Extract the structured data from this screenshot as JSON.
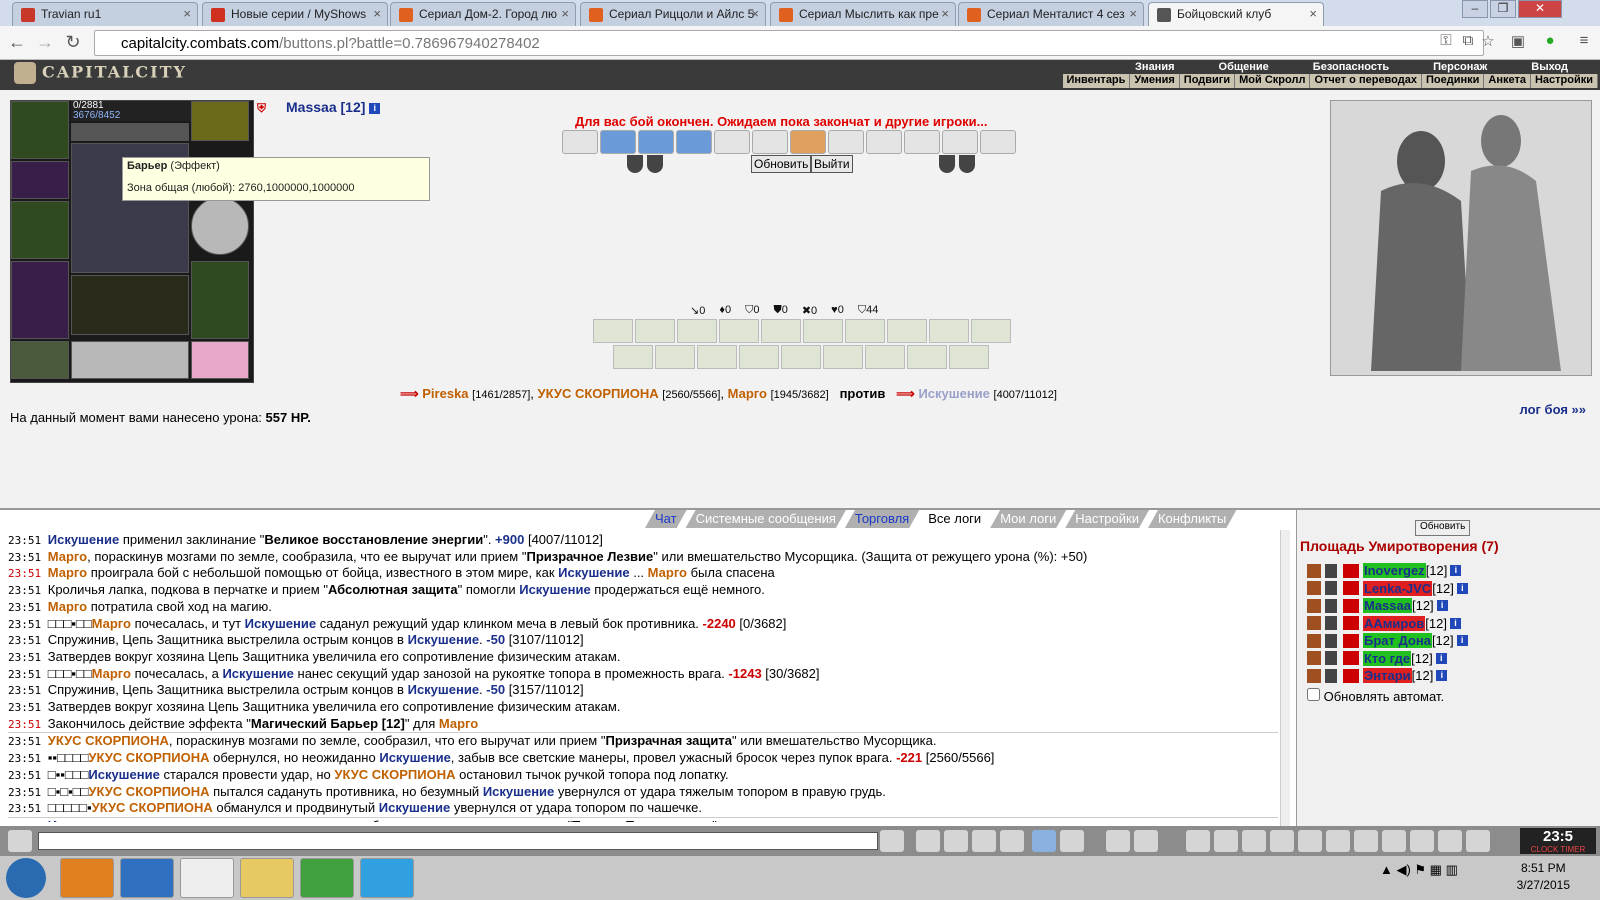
{
  "browser": {
    "tabs": [
      {
        "title": "Travian ru1",
        "color": "#c8382a"
      },
      {
        "title": "Новые серии / MyShows",
        "color": "#d03020"
      },
      {
        "title": "Сериал Дом-2. Город лю",
        "color": "#e06020"
      },
      {
        "title": "Сериал Риццоли и Айлс 5",
        "color": "#e06020"
      },
      {
        "title": "Сериал Мыслить как пре",
        "color": "#e06020"
      },
      {
        "title": "Сериал Менталист 4 сез",
        "color": "#e06020"
      },
      {
        "title": "Бойцовский клуб",
        "color": "#555555"
      }
    ],
    "url_host": "capitalcity.combats.com",
    "url_path": "/buttons.pl?battle=0.786967940278402"
  },
  "site": {
    "logo": "CAPITALCITY",
    "menu_top": [
      "Знания",
      "Общение",
      "Безопасность",
      "Персонаж",
      "Выход"
    ],
    "menu_sub": [
      "Инвентарь",
      "Умения",
      "Подвиги",
      "Мой Скролл",
      "Отчет о переводах",
      "Поединки",
      "Анкета",
      "Настройки"
    ]
  },
  "character": {
    "name": "Massaa [12]",
    "hp": "0/2881",
    "mana": "3676/8452",
    "tooltip_title": "Барьер",
    "tooltip_kind": "(Эффект)",
    "tooltip_body": "Зона общая (любой): 2760,1000000,1000000"
  },
  "battle": {
    "status": "Для вас бой окончен. Ожидаем пока закончат и другие игроки...",
    "refresh_btn": "Обновить",
    "exit_btn": "Выйти",
    "stats": [
      "↘0",
      "♦0",
      "⛉0",
      "⛊0",
      "✖0",
      "♥0",
      "⛉44"
    ],
    "team1": [
      {
        "name": "Pireska",
        "hp": "[1461/2857]"
      },
      {
        "name": "УКУС СКОРПИОНА",
        "hp": "[2560/5566]"
      },
      {
        "name": "Марго",
        "hp": "[1945/3682]"
      }
    ],
    "vs": "против",
    "team2": [
      {
        "name": "Искушение",
        "hp": "[4007/11012]"
      }
    ],
    "damage_label": "На данный момент вами нанесено урона:",
    "damage_value": "557 HP.",
    "log_link": "лог боя »»"
  },
  "chat": {
    "tabs": [
      "Чат",
      "Системные сообщения",
      "Торговля",
      "Все логи",
      "Мои логи",
      "Настройки",
      "Конфликты"
    ],
    "log": [
      {
        "time": "23:51",
        "red": false,
        "html": "<span class='nb'>Искушение</span> применил заклинание \"<span class='bold'>Великое восстановление энергии</span>\". <span class='nb'>+900</span> [4007/11012]"
      },
      {
        "time": "23:51",
        "red": false,
        "html": "<span class='no'>Марго</span>, пораскинув мозгами по земле, сообразила, что ее выручат или прием \"<span class='bold'>Призрачное Лезвие</span>\" или вмешательство Мусорщика. (Защита от режущего урона (%): +50)"
      },
      {
        "time": "23:51",
        "red": true,
        "html": "<span class='no'>Марго</span> проиграла бой с небольшой помощью от бойца, известного в этом мире, как <span class='nb'>Искушение</span> ... <span class='no'>Марго</span> была спасена"
      },
      {
        "time": "23:51",
        "red": false,
        "html": "Кроличья лапка, подкова в перчатке и прием \"<span class='bold'>Абсолютная защита</span>\" помогли <span class='nb'>Искушение</span> продержаться ещё немного."
      },
      {
        "time": "23:51",
        "red": false,
        "html": "<span class='no'>Марго</span> потратила свой ход на магию."
      },
      {
        "time": "23:51",
        "red": false,
        "html": "□□□▪□□<span class='no'>Марго</span> почесалась, и тут <span class='nb'>Искушение</span> саданул режущий удар клинком меча в левый бок противника. <span class='nr'>-2240</span> [0/3682]"
      },
      {
        "time": "23:51",
        "red": false,
        "html": "Спружинив, Цепь Защитника выстрелила острым концов в <span class='nb'>Искушение</span>. <span class='nb'>-50</span> [3107/11012]"
      },
      {
        "time": "23:51",
        "red": false,
        "html": "Затвердев вокруг хозяина Цепь Защитника увеличила его сопротивление физическим атакам."
      },
      {
        "time": "23:51",
        "red": false,
        "html": "□□□▪□□<span class='no'>Марго</span> почесалась, а <span class='nb'>Искушение</span> нанес секущий удар занозой на рукоятке топора в промежность врага. <span class='nr'>-1243</span> [30/3682]"
      },
      {
        "time": "23:51",
        "red": false,
        "html": "Спружинив, Цепь Защитника выстрелила острым концов в <span class='nb'>Искушение</span>. <span class='nb'>-50</span> [3157/11012]"
      },
      {
        "time": "23:51",
        "red": false,
        "html": "Затвердев вокруг хозяина Цепь Защитника увеличила его сопротивление физическим атакам."
      },
      {
        "time": "23:51",
        "red": true,
        "html": "Закончилось действие эффекта \"<span class='bold'>Магический Барьер [12]</span>\" для <span class='no'>Марго</span>"
      },
      {
        "time": "23:51",
        "red": false,
        "sep": true,
        "html": "<span class='no'>УКУС СКОРПИОНА</span>, пораскинув мозгами по земле, сообразил, что его выручат или прием \"<span class='bold'>Призрачная защита</span>\" или вмешательство Мусорщика."
      },
      {
        "time": "23:51",
        "red": false,
        "html": "▪▪□□□□<span class='no'>УКУС СКОРПИОНА</span> обернулся, но неожиданно <span class='nb'>Искушение</span>, забыв все светские манеры, провел ужасный бросок через пупок врага. <span class='nr'>-221</span> [2560/5566]"
      },
      {
        "time": "23:51",
        "red": false,
        "html": "□▪▪□□□<span class='nb'>Искушение</span> старался провести удар, но <span class='no'>УКУС СКОРПИОНА</span> остановил тычок ручкой топора под лопатку."
      },
      {
        "time": "23:51",
        "red": false,
        "html": "□▪□▪□□<span class='no'>УКУС СКОРПИОНА</span> пытался садануть противника, но безумный <span class='nb'>Искушение</span> увернулся от удара тяжелым топором в правую грудь."
      },
      {
        "time": "23:51",
        "red": false,
        "html": "□□□□□▪<span class='no'>УКУС СКОРПИОНА</span> обманулся и продвинутый <span class='nb'>Искушение</span> увернулся от удара топором по чашечке."
      },
      {
        "time": "23:51",
        "red": false,
        "sep": true,
        "html": "<span class='nb'>Искушение</span> закричал от испуга, и неожиданно для себя самого сотворил заклинание \"<span class='bold'>Тактика Парирования</span>\"."
      }
    ]
  },
  "location": {
    "refresh_btn": "Обновить",
    "title": "Площадь Умиротворения (7)",
    "players": [
      {
        "name": "Inovergez",
        "level": "[12]",
        "bg": "g"
      },
      {
        "name": "Lenka-JVC",
        "level": "[12]",
        "bg": "rd"
      },
      {
        "name": "Massaa",
        "level": "[12]",
        "bg": "g"
      },
      {
        "name": "AAмиров",
        "level": "[12]",
        "bg": "rd"
      },
      {
        "name": "Брат Дона",
        "level": "[12]",
        "bg": "g"
      },
      {
        "name": "Кто где",
        "level": "[12]",
        "bg": "g"
      },
      {
        "name": "Энтари",
        "level": "[12]",
        "bg": "rd"
      }
    ],
    "auto_refresh": "Обновлять автомат."
  },
  "clock": {
    "game_time": "23:5",
    "label": "CLOCK TIMER"
  },
  "os": {
    "time": "8:51 PM",
    "date": "3/27/2015"
  }
}
